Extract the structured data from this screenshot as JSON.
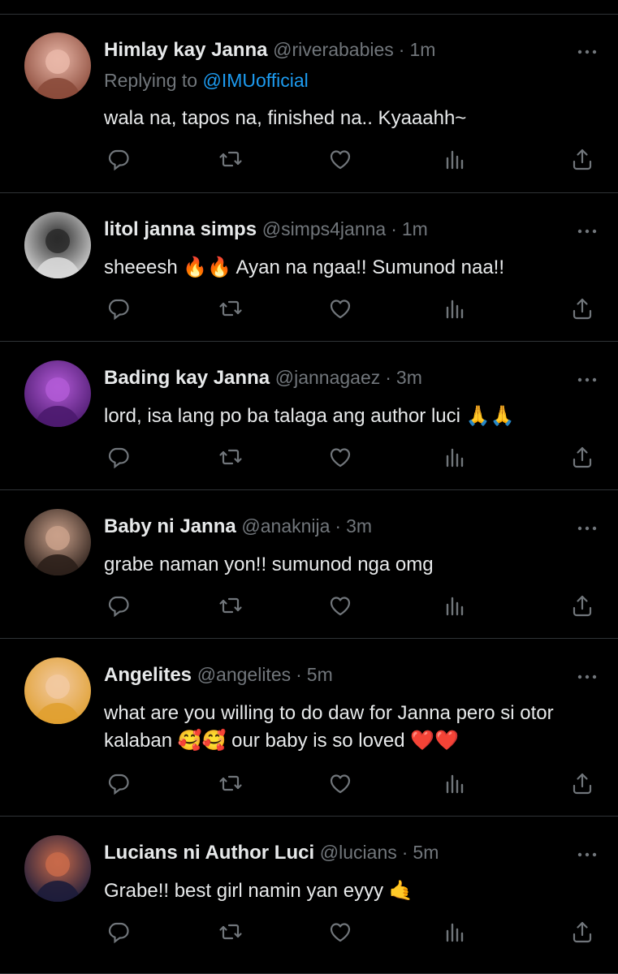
{
  "tweets": [
    {
      "name": "Himlay kay Janna",
      "handle": "@riverababies",
      "time": "1m",
      "replying_prefix": "Replying to ",
      "replying_to": "@IMUofficial",
      "text": "wala na, tapos na, finished na.. Kyaaahh~",
      "avatar_colors": [
        "#8a4a3a",
        "#e9b7a8"
      ]
    },
    {
      "name": "litol janna simps",
      "handle": "@simps4janna",
      "time": "1m",
      "text": "sheeesh 🔥🔥 Ayan na ngaa!! Sumunod naa!!",
      "avatar_colors": [
        "#d9d9d9",
        "#2a2a2a"
      ]
    },
    {
      "name": "Bading kay Janna",
      "handle": "@jannagaez",
      "time": "3m",
      "text": "lord, isa lang po ba talaga ang author luci 🙏🙏",
      "avatar_colors": [
        "#4b1a6e",
        "#b25ad6"
      ]
    },
    {
      "name": "Baby ni Janna",
      "handle": "@anaknija",
      "time": "3m",
      "text": "grabe naman yon!! sumunod nga omg",
      "avatar_colors": [
        "#2b1f1a",
        "#c9a08a"
      ]
    },
    {
      "name": "Angelites",
      "handle": "@angelites",
      "time": "5m",
      "text": "what are you willing to do daw for Janna pero si otor kalaban 🥰🥰 our baby is so loved ❤️❤️",
      "avatar_colors": [
        "#e0a030",
        "#f2c9a0"
      ]
    },
    {
      "name": "Lucians ni Author Luci",
      "handle": "@lucians",
      "time": "5m",
      "text": "Grabe!! best girl namin yan eyyy 🤙",
      "avatar_colors": [
        "#1c1c3a",
        "#c86a4a"
      ]
    }
  ],
  "colors": {
    "background": "#000000",
    "primary_text": "#e7e9ea",
    "secondary_text": "#71767b",
    "link": "#1d9bf0",
    "divider": "#2f3336"
  },
  "icons": [
    "more-icon",
    "reply-icon",
    "retweet-icon",
    "like-icon",
    "views-icon",
    "share-icon"
  ]
}
